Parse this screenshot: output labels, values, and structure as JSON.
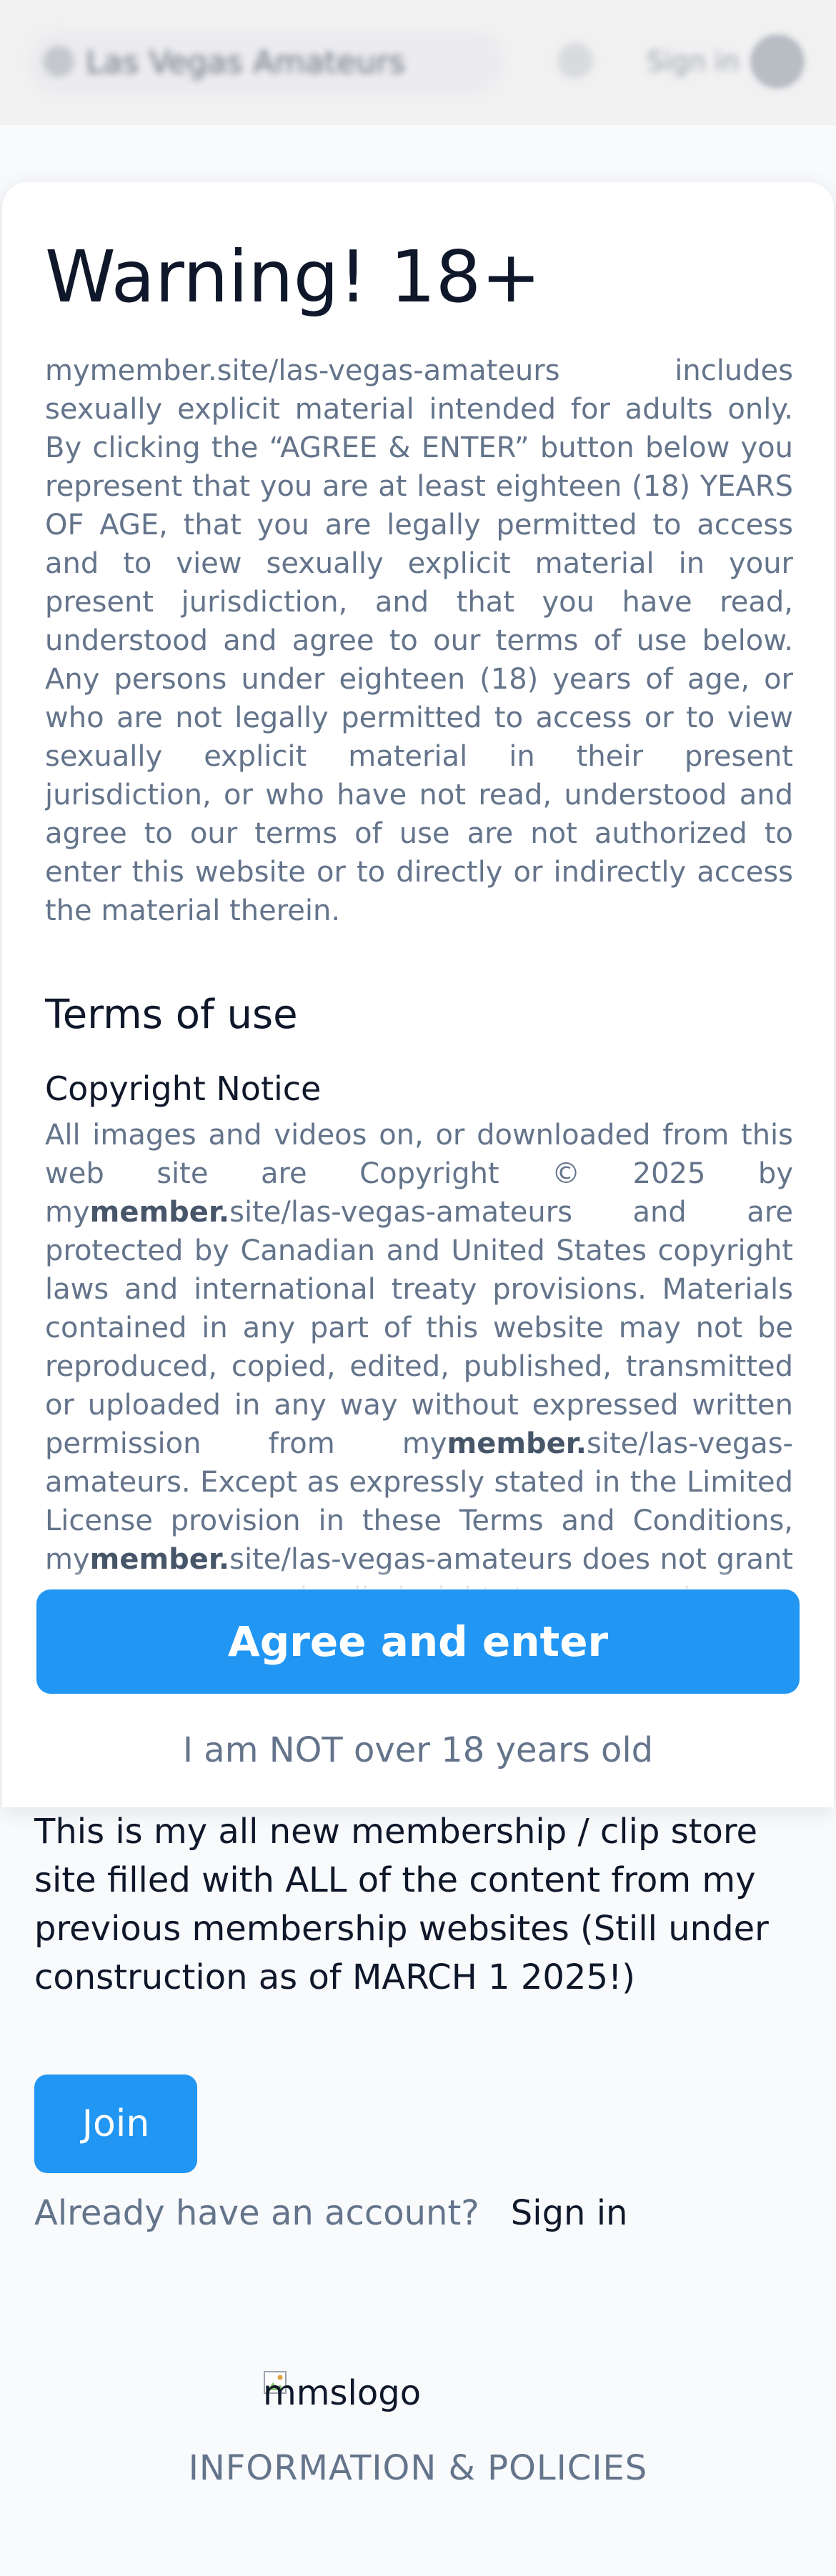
{
  "header": {
    "title": "Las Vegas Amateurs",
    "sign_in": "Sign in"
  },
  "age_gate": {
    "title": "Warning! 18+",
    "warning_text": "mymember.site/las-vegas-amateurs includes sexually explicit material intended for adults only. By clicking the “AGREE & ENTER” button below you represent that you are at least eighteen (18) YEARS OF AGE, that you are legally permitted to access and to view sexually explicit material in your present jurisdiction, and that you have read, understood and agree to our terms of use below. Any persons under eighteen (18) years of age, or who are not legally permitted to access or to view sexually explicit material in their present jurisdiction, or who have not read, understood and agree to our terms of use are not authorized to enter this website or to directly or indirectly access the material therein.",
    "terms_title": "Terms of use",
    "copyright_title": "Copyright Notice",
    "copyright": {
      "p1": "All images and videos on, or downloaded from this web site are Copyright © 2025 by ",
      "brand_prefix": "my",
      "brand_bold": "member.",
      "brand_suffix": "site/las-vegas-amateurs",
      "p2": " and are protected by Canadian and United States copyright laws and international treaty provisions. Materials contained in any part of this website may not be reproduced, copied, edited, published, transmitted or uploaded in any way without expressed written permission from ",
      "p3": ". Except as expressly stated in the Limited License provision in these Terms and Conditions, ",
      "p4": " does not grant any express or implied right to you under any patents, trademarks, copyrights or trade secret information."
    },
    "agree_button": "Agree and enter",
    "not_over_link": "I am NOT over 18 years old"
  },
  "main": {
    "intro": "This is my all new membership / clip store site filled with ALL of the content from my previous membership websites (Still under construction as of MARCH 1 2025!)",
    "join_button": "Join",
    "account_question": "Already have an account?",
    "sign_in_link": "Sign in"
  },
  "footer": {
    "logo_alt": "mmslogo",
    "info_link": "INFORMATION & POLICIES"
  },
  "colors": {
    "accent": "#2196f3",
    "muted_text": "#64748b",
    "body_text": "#0f172a"
  },
  "icons": {
    "header_search": "search-icon",
    "header_avatar": "user-avatar-icon",
    "logo_placeholder": "broken-image-icon"
  }
}
